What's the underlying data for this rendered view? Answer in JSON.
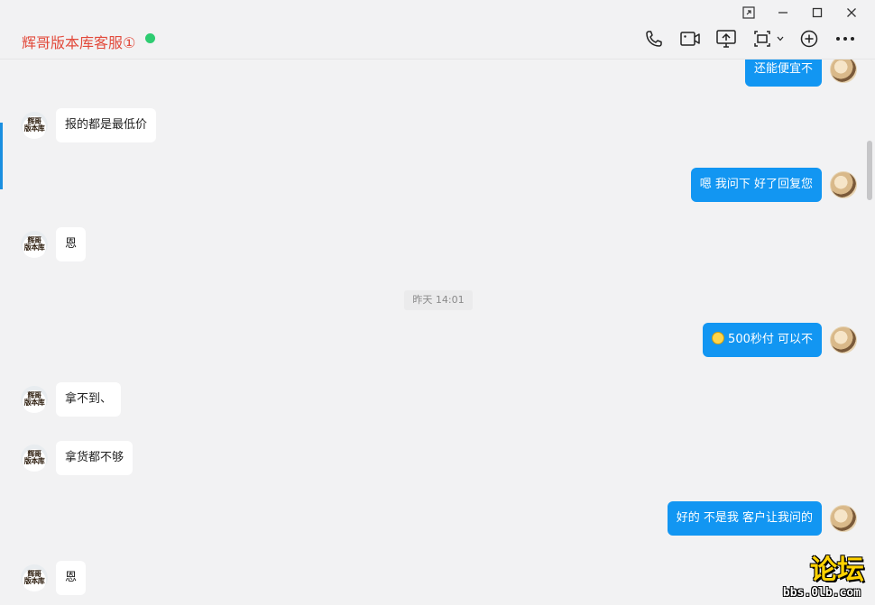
{
  "window": {
    "controls": [
      "pin-icon",
      "minimize-icon",
      "maximize-icon",
      "close-icon"
    ]
  },
  "header": {
    "title": "辉哥版本库客服①",
    "online_color": "#2ecc71",
    "title_color": "#e24a3b",
    "toolbar": [
      "phone-icon",
      "video-icon",
      "screen-share-icon",
      "screenshot-icon",
      "add-icon",
      "more-icon"
    ]
  },
  "shop_avatar_text": [
    "辉哥",
    "版本库"
  ],
  "messages": [
    {
      "side": "out",
      "text": "还能便宜不"
    },
    {
      "side": "in",
      "text": "报的都是最低价"
    },
    {
      "side": "out",
      "text": "嗯 我问下 好了回复您"
    },
    {
      "side": "in",
      "text": "恩"
    },
    {
      "side": "time",
      "text": "昨天 14:01"
    },
    {
      "side": "out",
      "text": "500秒付 可以不",
      "emoji": "grin"
    },
    {
      "side": "in",
      "text": "拿不到、"
    },
    {
      "side": "in",
      "text": "拿货都不够"
    },
    {
      "side": "out",
      "text": "好的 不是我 客户让我问的"
    },
    {
      "side": "in",
      "text": "恩"
    }
  ],
  "watermark": {
    "text": "论坛",
    "url": "bbs.0lb.com"
  },
  "colors": {
    "accent": "#1296f2",
    "background": "#f2f2f3"
  }
}
